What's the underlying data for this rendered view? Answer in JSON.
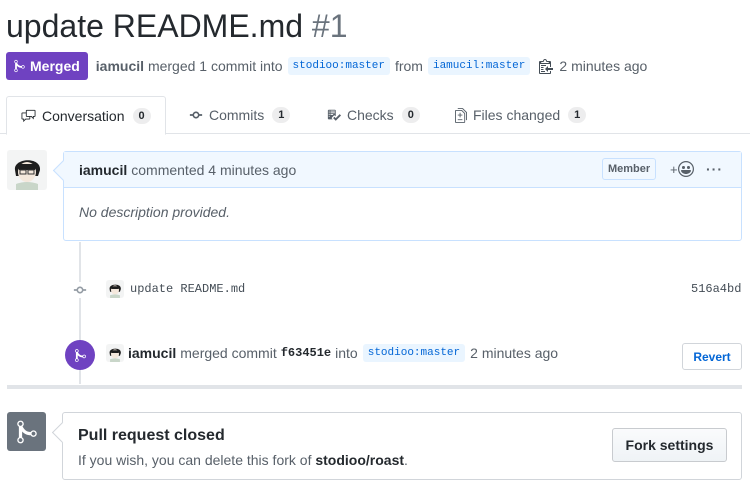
{
  "pr": {
    "title": "update README.md",
    "number": "#1",
    "state_label": "Merged",
    "author": "iamucil",
    "merge_summary": "merged 1 commit into",
    "base_branch": "stodioo:master",
    "from_text": "from",
    "head_branch": "iamucil:master",
    "time": "2 minutes ago"
  },
  "tabs": [
    {
      "label": "Conversation",
      "count": "0",
      "icon": "conversation-icon"
    },
    {
      "label": "Commits",
      "count": "1",
      "icon": "commit-icon"
    },
    {
      "label": "Checks",
      "count": "0",
      "icon": "checklist-icon"
    },
    {
      "label": "Files changed",
      "count": "1",
      "icon": "file-diff-icon"
    }
  ],
  "comment": {
    "author": "iamucil",
    "action": "commented 4 minutes ago",
    "role_badge": "Member",
    "reaction_label": "+",
    "more_label": "···",
    "body": "No description provided."
  },
  "commit": {
    "message": "update README.md",
    "sha": "516a4bd"
  },
  "merge_event": {
    "actor": "iamucil",
    "action": "merged commit",
    "sha": "f63451e",
    "into_text": "into",
    "branch": "stodioo:master",
    "time": "2 minutes ago",
    "revert_label": "Revert"
  },
  "closed": {
    "title": "Pull request closed",
    "desc_prefix": "If you wish, you can delete this fork of",
    "repo": "stodioo/roast",
    "desc_suffix": ".",
    "fork_settings_label": "Fork settings"
  },
  "colors": {
    "merged_purple": "#6f42c1",
    "link_blue": "#0366d6",
    "muted_text": "#586069",
    "closed_gray": "#6a737d"
  }
}
